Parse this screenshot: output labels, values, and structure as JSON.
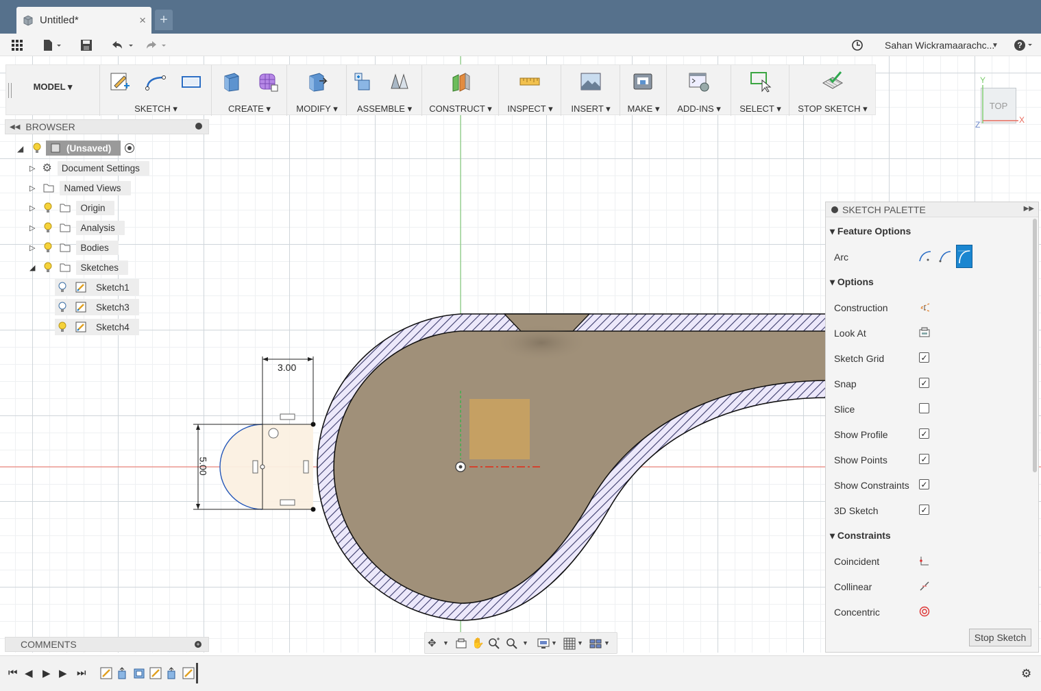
{
  "app": {
    "doc_title": "Untitled*",
    "close_glyph": "×",
    "new_tab_glyph": "+"
  },
  "quick_access": {
    "user_name": "Sahan Wickramaarachc...",
    "help_glyph": "?"
  },
  "toolbar": {
    "model_label": "MODEL ▾",
    "groups": [
      {
        "label": "SKETCH ▾"
      },
      {
        "label": "CREATE ▾"
      },
      {
        "label": "MODIFY ▾"
      },
      {
        "label": "ASSEMBLE ▾"
      },
      {
        "label": "CONSTRUCT ▾"
      },
      {
        "label": "INSPECT ▾"
      },
      {
        "label": "INSERT ▾"
      },
      {
        "label": "MAKE ▾"
      },
      {
        "label": "ADD-INS ▾"
      },
      {
        "label": "SELECT ▾"
      },
      {
        "label": "STOP SKETCH ▾"
      }
    ]
  },
  "browser": {
    "title": "BROWSER",
    "root": "(Unsaved)",
    "items": [
      {
        "label": "Document Settings"
      },
      {
        "label": "Named Views"
      },
      {
        "label": "Origin"
      },
      {
        "label": "Analysis"
      },
      {
        "label": "Bodies"
      },
      {
        "label": "Sketches"
      },
      {
        "label": "Sketch1"
      },
      {
        "label": "Sketch3"
      },
      {
        "label": "Sketch4"
      }
    ]
  },
  "comments": {
    "title": "COMMENTS"
  },
  "canvas": {
    "dim_horizontal": "3.00",
    "dim_vertical": "5.00",
    "viewcube_face": "TOP",
    "axis_x": "X",
    "axis_y": "Y",
    "axis_z": "Z"
  },
  "palette": {
    "title": "SKETCH PALETTE",
    "sections": {
      "feature_options": "Feature Options",
      "options": "Options",
      "constraints": "Constraints"
    },
    "feature_rows": [
      {
        "label": "Arc"
      }
    ],
    "option_rows": [
      {
        "label": "Construction",
        "type": "icon"
      },
      {
        "label": "Look At",
        "type": "icon"
      },
      {
        "label": "Sketch Grid",
        "type": "checkbox",
        "checked": true
      },
      {
        "label": "Snap",
        "type": "checkbox",
        "checked": true
      },
      {
        "label": "Slice",
        "type": "checkbox",
        "checked": false
      },
      {
        "label": "Show Profile",
        "type": "checkbox",
        "checked": true
      },
      {
        "label": "Show Points",
        "type": "checkbox",
        "checked": true
      },
      {
        "label": "Show Constraints",
        "type": "checkbox",
        "checked": true
      },
      {
        "label": "3D Sketch",
        "type": "checkbox",
        "checked": true
      }
    ],
    "constraint_rows": [
      {
        "label": "Coincident"
      },
      {
        "label": "Collinear"
      },
      {
        "label": "Concentric"
      }
    ],
    "stop_button": "Stop Sketch"
  },
  "colors": {
    "titlebar": "#56718c",
    "body_fill": "#a09079",
    "hatch": "#8e86cc",
    "profile_fill": "#f6e7d3",
    "accent_blue": "#1a86d0"
  }
}
